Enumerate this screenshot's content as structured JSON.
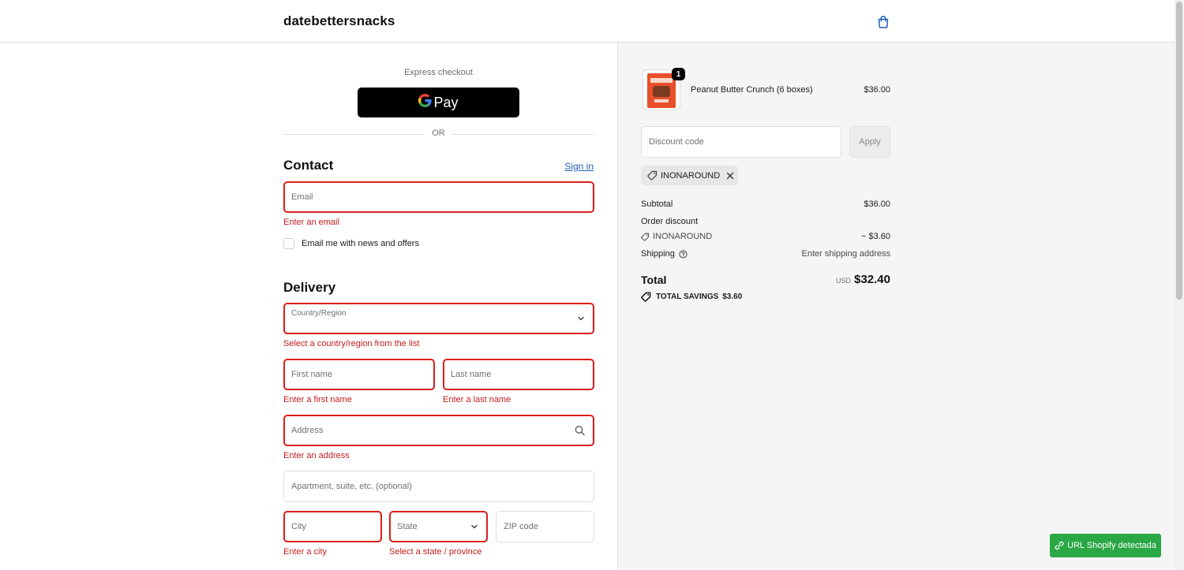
{
  "header": {
    "brand": "datebettersnacks",
    "cart_icon": "shopping-bag-icon"
  },
  "express": {
    "label": "Express checkout",
    "gpay_g": "G",
    "gpay_label": "Pay",
    "or_label": "OR"
  },
  "contact": {
    "title": "Contact",
    "signin_label": "Sign in",
    "email_placeholder": "Email",
    "email_error": "Enter an email",
    "newsletter_label": "Email me with news and offers"
  },
  "delivery": {
    "title": "Delivery",
    "country_label": "Country/Region",
    "country_error": "Select a country/region from the list",
    "first_name_placeholder": "First name",
    "first_name_error": "Enter a first name",
    "last_name_placeholder": "Last name",
    "last_name_error": "Enter a last name",
    "address_placeholder": "Address",
    "address_error": "Enter an address",
    "apartment_placeholder": "Apartment, suite, etc. (optional)",
    "city_placeholder": "City",
    "city_error": "Enter a city",
    "state_placeholder": "State",
    "state_error": "Select a state / province",
    "zip_placeholder": "ZIP code"
  },
  "summary": {
    "item": {
      "quantity": "1",
      "name": "Peanut Butter Crunch (6 boxes)",
      "price": "$36.00"
    },
    "discount_placeholder": "Discount code",
    "apply_label": "Apply",
    "applied_code": "INONAROUND",
    "subtotal_label": "Subtotal",
    "subtotal_value": "$36.00",
    "order_discount_label": "Order discount",
    "discount_code_label": "INONAROUND",
    "discount_value": "− $3.60",
    "shipping_label": "Shipping",
    "shipping_value": "Enter shipping address",
    "total_label": "Total",
    "total_currency": "USD",
    "total_value": "$32.40",
    "savings_label": "TOTAL SAVINGS",
    "savings_value": "$3.60"
  },
  "extension_badge": {
    "label": "URL Shopify detectada"
  },
  "colors": {
    "error": "#dd1d1d",
    "link": "#1f5fb6",
    "badge_green": "#2aa845",
    "summary_bg": "#f5f5f5"
  }
}
